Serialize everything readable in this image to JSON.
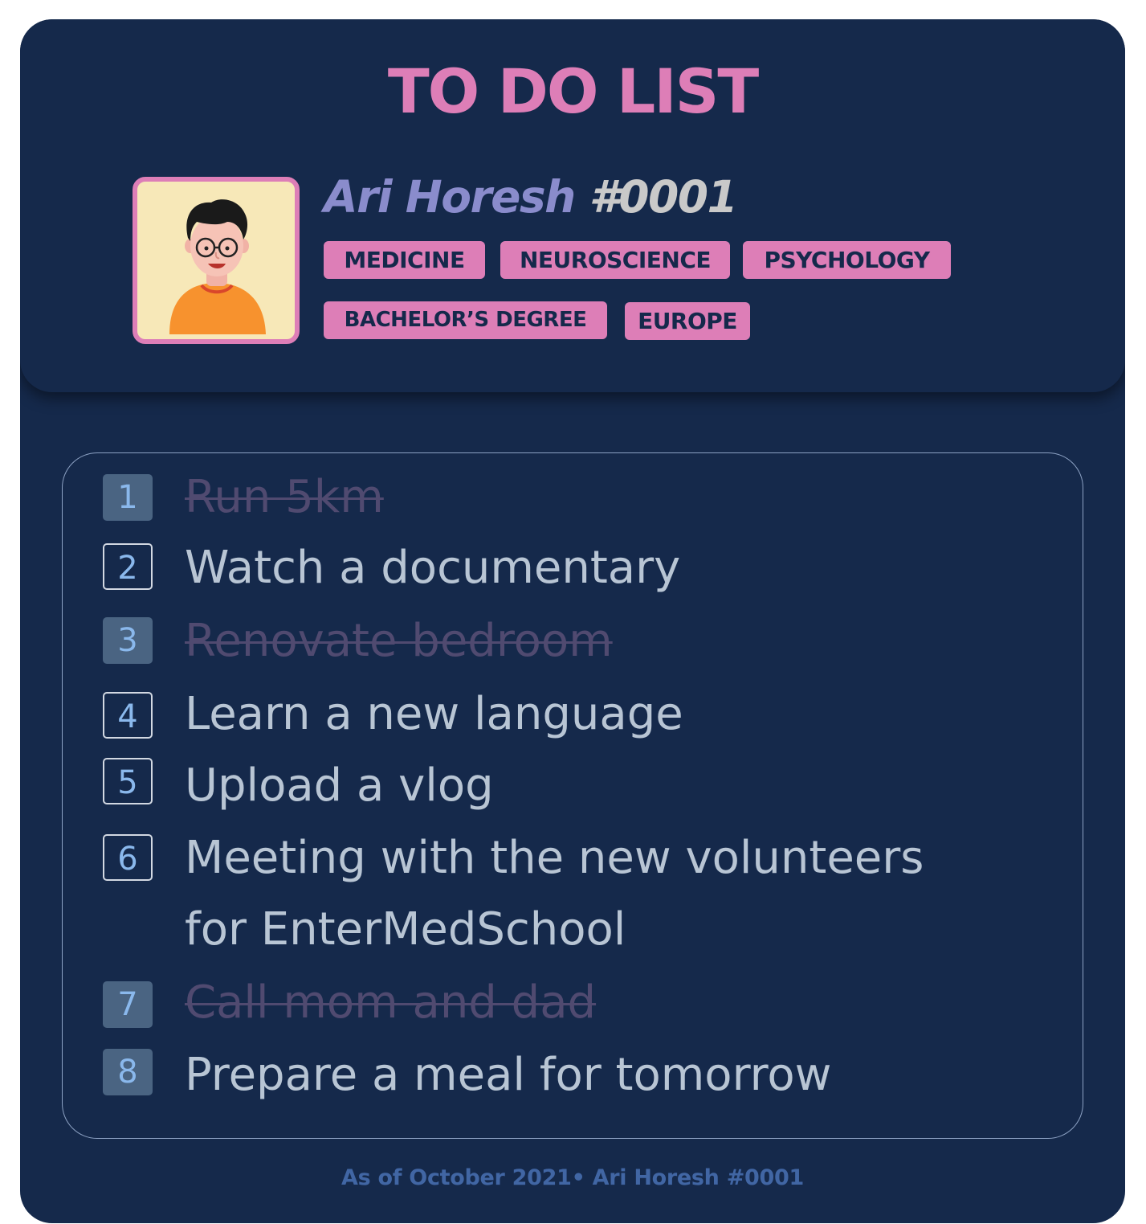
{
  "colors": {
    "background": "#15294b",
    "accent": "#dd7eb7",
    "name": "#8a8ccc",
    "user_id": "#c9c9c9",
    "task_text": "#b8c5d4",
    "task_done_text": "#504a70",
    "number": "#8ab8ec",
    "footer": "#4166a4"
  },
  "header": {
    "title": "TO DO LIST",
    "avatar_icon": "cartoon-avatar-icon",
    "user_name": "Ari Horesh",
    "user_id": "#0001",
    "tags": [
      "MEDICINE",
      "NEUROSCIENCE",
      "PSYCHOLOGY",
      "BACHELOR’S DEGREE",
      "EUROPE"
    ]
  },
  "tasks": [
    {
      "number": "1",
      "lines": [
        "Run 5km"
      ],
      "done": true
    },
    {
      "number": "2",
      "lines": [
        "Watch a documentary"
      ],
      "done": false
    },
    {
      "number": "3",
      "lines": [
        "Renovate bedroom"
      ],
      "done": true
    },
    {
      "number": "4",
      "lines": [
        "Learn a new language"
      ],
      "done": false
    },
    {
      "number": "5",
      "lines": [
        "Upload a vlog"
      ],
      "done": false
    },
    {
      "number": "6",
      "lines": [
        "Meeting with the new volunteers",
        "for EnterMedSchool"
      ],
      "done": false
    },
    {
      "number": "7",
      "lines": [
        "Call mom and dad"
      ],
      "done": true
    },
    {
      "number": "8",
      "lines": [
        "Prepare a meal for tomorrow"
      ],
      "done": true
    }
  ],
  "footer": {
    "text": "As of October 2021• Ari Horesh #0001"
  }
}
